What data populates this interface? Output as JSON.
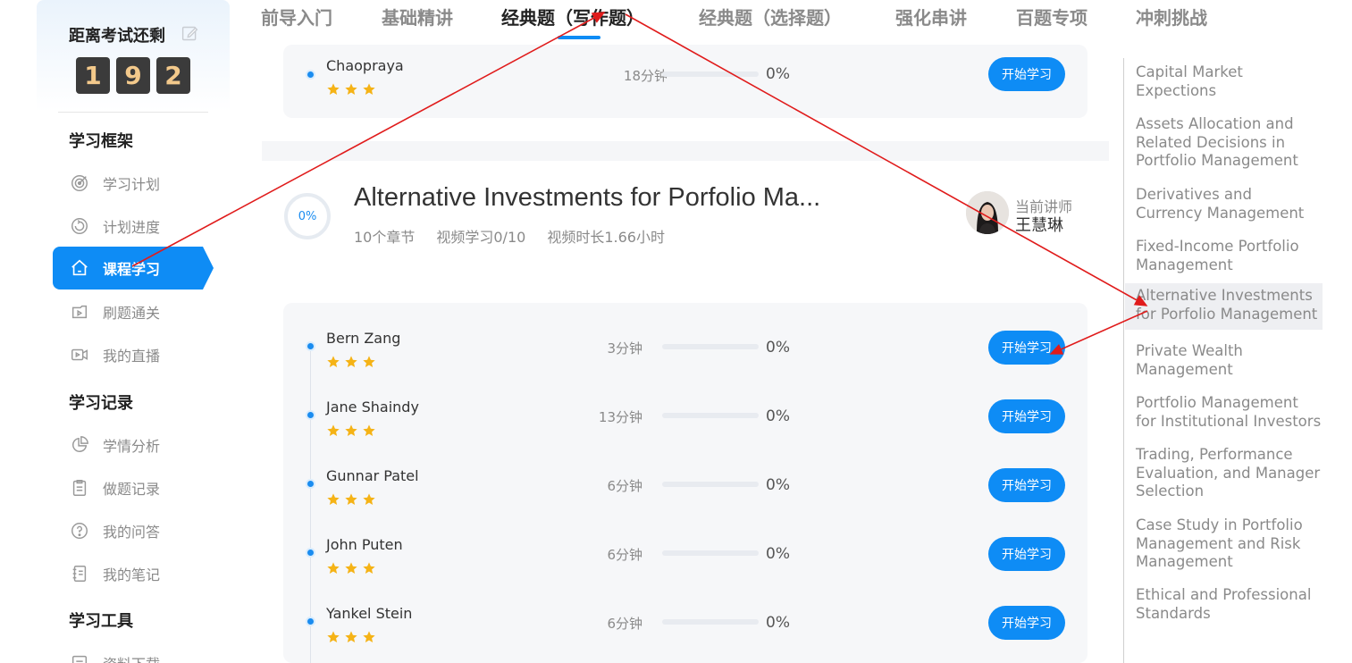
{
  "countdown": {
    "title": "距离考试还剩",
    "digits": [
      "1",
      "9",
      "2"
    ]
  },
  "sidebar": {
    "sections": [
      {
        "title": "学习框架",
        "items": [
          {
            "label": "学习计划",
            "icon": "target-icon",
            "active": false
          },
          {
            "label": "计划进度",
            "icon": "progress-icon",
            "active": false
          },
          {
            "label": "课程学习",
            "icon": "home-icon",
            "active": true
          },
          {
            "label": "刷题通关",
            "icon": "practice-icon",
            "active": false
          },
          {
            "label": "我的直播",
            "icon": "live-video-icon",
            "active": false
          }
        ]
      },
      {
        "title": "学习记录",
        "items": [
          {
            "label": "学情分析",
            "icon": "pie-chart-icon",
            "active": false
          },
          {
            "label": "做题记录",
            "icon": "document-icon",
            "active": false
          },
          {
            "label": "我的问答",
            "icon": "question-icon",
            "active": false
          },
          {
            "label": "我的笔记",
            "icon": "notebook-icon",
            "active": false
          }
        ]
      },
      {
        "title": "学习工具",
        "items": [
          {
            "label": "资料下载",
            "icon": "download-icon",
            "active": false
          }
        ]
      }
    ]
  },
  "tabs": [
    {
      "label": "前导入门",
      "active": false
    },
    {
      "label": "基础精讲",
      "active": false
    },
    {
      "label": "经典题（写作题）",
      "active": true
    },
    {
      "label": "经典题（选择题）",
      "active": false
    },
    {
      "label": "强化串讲",
      "active": false
    },
    {
      "label": "百题专项",
      "active": false
    },
    {
      "label": "冲刺挑战",
      "active": false
    }
  ],
  "previous_course": {
    "lessons": [
      {
        "name": "Chaopraya",
        "stars": 3,
        "duration": "18分钟",
        "progress": 0,
        "progress_text": "0%",
        "button": "开始学习"
      }
    ]
  },
  "course": {
    "progress_text": "0%",
    "progress": 0,
    "title": "Alternative Investments for Porfolio Ma...",
    "meta": {
      "chapters": "10个章节",
      "video_progress": "视频学习0/10",
      "video_length": "视频时长1.66小时"
    },
    "teacher_caption": "当前讲师",
    "teacher_name": "王慧琳",
    "lessons": [
      {
        "name": "Bern Zang",
        "stars": 3,
        "duration": "3分钟",
        "progress": 0,
        "progress_text": "0%",
        "button": "开始学习"
      },
      {
        "name": "Jane Shaindy",
        "stars": 3,
        "duration": "13分钟",
        "progress": 0,
        "progress_text": "0%",
        "button": "开始学习"
      },
      {
        "name": "Gunnar Patel",
        "stars": 3,
        "duration": "6分钟",
        "progress": 0,
        "progress_text": "0%",
        "button": "开始学习"
      },
      {
        "name": "John Puten",
        "stars": 3,
        "duration": "6分钟",
        "progress": 0,
        "progress_text": "0%",
        "button": "开始学习"
      },
      {
        "name": "Yankel Stein",
        "stars": 3,
        "duration": "6分钟",
        "progress": 0,
        "progress_text": "0%",
        "button": "开始学习"
      }
    ]
  },
  "outline": [
    {
      "label": "Capital Market Expections",
      "active": false
    },
    {
      "label": "Assets Allocation and Related Decisions in Portfolio Management",
      "active": false
    },
    {
      "label": "Derivatives and Currency Management",
      "active": false
    },
    {
      "label": "Fixed-Income Portfolio Management",
      "active": false
    },
    {
      "label": "Alternative Investments for Porfolio Management",
      "active": true
    },
    {
      "label": "Private Wealth Management",
      "active": false
    },
    {
      "label": "Portfolio Management for Institutional Investors",
      "active": false
    },
    {
      "label": "Trading, Performance Evaluation, and Manager Selection",
      "active": false
    },
    {
      "label": "Case Study in Portfolio Management and Risk Management",
      "active": false
    },
    {
      "label": "Ethical and Professional Standards",
      "active": false
    }
  ],
  "colors": {
    "accent": "#0e8cf5",
    "star": "#f5b316",
    "annotation_arrow": "#e01b1b",
    "digit_bg": "#3b3b3b",
    "digit_fg": "#f3c98b"
  }
}
